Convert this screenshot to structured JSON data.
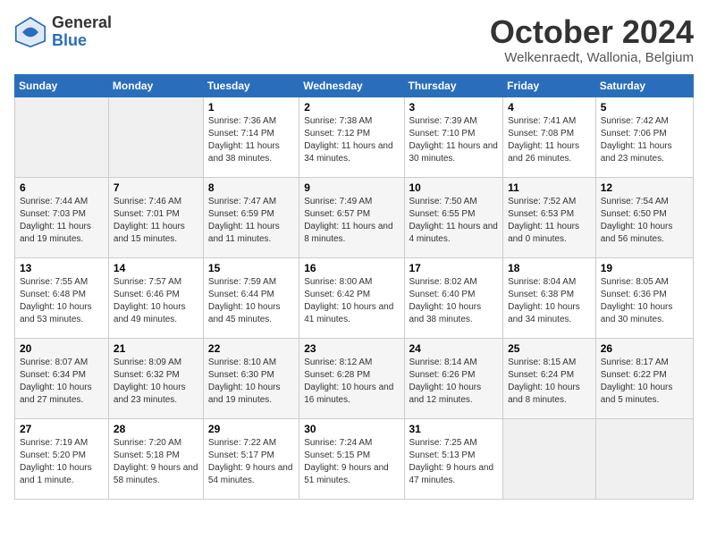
{
  "logo": {
    "general": "General",
    "blue": "Blue"
  },
  "header": {
    "title": "October 2024",
    "subtitle": "Welkenraedt, Wallonia, Belgium"
  },
  "weekdays": [
    "Sunday",
    "Monday",
    "Tuesday",
    "Wednesday",
    "Thursday",
    "Friday",
    "Saturday"
  ],
  "weeks": [
    [
      {
        "day": "",
        "info": ""
      },
      {
        "day": "",
        "info": ""
      },
      {
        "day": "1",
        "info": "Sunrise: 7:36 AM\nSunset: 7:14 PM\nDaylight: 11 hours and 38 minutes."
      },
      {
        "day": "2",
        "info": "Sunrise: 7:38 AM\nSunset: 7:12 PM\nDaylight: 11 hours and 34 minutes."
      },
      {
        "day": "3",
        "info": "Sunrise: 7:39 AM\nSunset: 7:10 PM\nDaylight: 11 hours and 30 minutes."
      },
      {
        "day": "4",
        "info": "Sunrise: 7:41 AM\nSunset: 7:08 PM\nDaylight: 11 hours and 26 minutes."
      },
      {
        "day": "5",
        "info": "Sunrise: 7:42 AM\nSunset: 7:06 PM\nDaylight: 11 hours and 23 minutes."
      }
    ],
    [
      {
        "day": "6",
        "info": "Sunrise: 7:44 AM\nSunset: 7:03 PM\nDaylight: 11 hours and 19 minutes."
      },
      {
        "day": "7",
        "info": "Sunrise: 7:46 AM\nSunset: 7:01 PM\nDaylight: 11 hours and 15 minutes."
      },
      {
        "day": "8",
        "info": "Sunrise: 7:47 AM\nSunset: 6:59 PM\nDaylight: 11 hours and 11 minutes."
      },
      {
        "day": "9",
        "info": "Sunrise: 7:49 AM\nSunset: 6:57 PM\nDaylight: 11 hours and 8 minutes."
      },
      {
        "day": "10",
        "info": "Sunrise: 7:50 AM\nSunset: 6:55 PM\nDaylight: 11 hours and 4 minutes."
      },
      {
        "day": "11",
        "info": "Sunrise: 7:52 AM\nSunset: 6:53 PM\nDaylight: 11 hours and 0 minutes."
      },
      {
        "day": "12",
        "info": "Sunrise: 7:54 AM\nSunset: 6:50 PM\nDaylight: 10 hours and 56 minutes."
      }
    ],
    [
      {
        "day": "13",
        "info": "Sunrise: 7:55 AM\nSunset: 6:48 PM\nDaylight: 10 hours and 53 minutes."
      },
      {
        "day": "14",
        "info": "Sunrise: 7:57 AM\nSunset: 6:46 PM\nDaylight: 10 hours and 49 minutes."
      },
      {
        "day": "15",
        "info": "Sunrise: 7:59 AM\nSunset: 6:44 PM\nDaylight: 10 hours and 45 minutes."
      },
      {
        "day": "16",
        "info": "Sunrise: 8:00 AM\nSunset: 6:42 PM\nDaylight: 10 hours and 41 minutes."
      },
      {
        "day": "17",
        "info": "Sunrise: 8:02 AM\nSunset: 6:40 PM\nDaylight: 10 hours and 38 minutes."
      },
      {
        "day": "18",
        "info": "Sunrise: 8:04 AM\nSunset: 6:38 PM\nDaylight: 10 hours and 34 minutes."
      },
      {
        "day": "19",
        "info": "Sunrise: 8:05 AM\nSunset: 6:36 PM\nDaylight: 10 hours and 30 minutes."
      }
    ],
    [
      {
        "day": "20",
        "info": "Sunrise: 8:07 AM\nSunset: 6:34 PM\nDaylight: 10 hours and 27 minutes."
      },
      {
        "day": "21",
        "info": "Sunrise: 8:09 AM\nSunset: 6:32 PM\nDaylight: 10 hours and 23 minutes."
      },
      {
        "day": "22",
        "info": "Sunrise: 8:10 AM\nSunset: 6:30 PM\nDaylight: 10 hours and 19 minutes."
      },
      {
        "day": "23",
        "info": "Sunrise: 8:12 AM\nSunset: 6:28 PM\nDaylight: 10 hours and 16 minutes."
      },
      {
        "day": "24",
        "info": "Sunrise: 8:14 AM\nSunset: 6:26 PM\nDaylight: 10 hours and 12 minutes."
      },
      {
        "day": "25",
        "info": "Sunrise: 8:15 AM\nSunset: 6:24 PM\nDaylight: 10 hours and 8 minutes."
      },
      {
        "day": "26",
        "info": "Sunrise: 8:17 AM\nSunset: 6:22 PM\nDaylight: 10 hours and 5 minutes."
      }
    ],
    [
      {
        "day": "27",
        "info": "Sunrise: 7:19 AM\nSunset: 5:20 PM\nDaylight: 10 hours and 1 minute."
      },
      {
        "day": "28",
        "info": "Sunrise: 7:20 AM\nSunset: 5:18 PM\nDaylight: 9 hours and 58 minutes."
      },
      {
        "day": "29",
        "info": "Sunrise: 7:22 AM\nSunset: 5:17 PM\nDaylight: 9 hours and 54 minutes."
      },
      {
        "day": "30",
        "info": "Sunrise: 7:24 AM\nSunset: 5:15 PM\nDaylight: 9 hours and 51 minutes."
      },
      {
        "day": "31",
        "info": "Sunrise: 7:25 AM\nSunset: 5:13 PM\nDaylight: 9 hours and 47 minutes."
      },
      {
        "day": "",
        "info": ""
      },
      {
        "day": "",
        "info": ""
      }
    ]
  ]
}
